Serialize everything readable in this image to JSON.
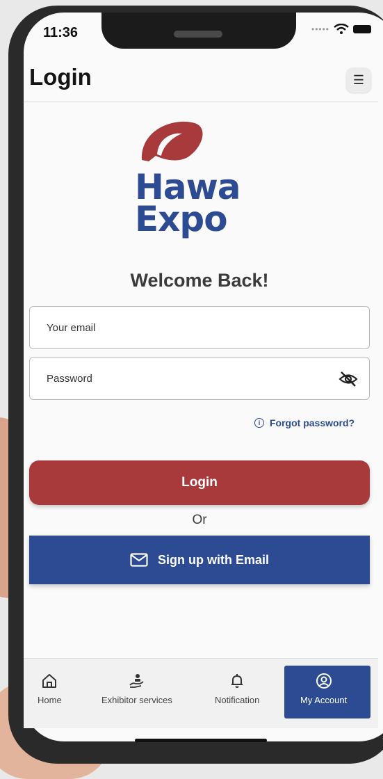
{
  "status": {
    "time": "11:36"
  },
  "header": {
    "title": "Login",
    "menu_icon": "menu-icon"
  },
  "logo": {
    "line1": "Hawa",
    "line2": "Expo",
    "brand_red": "#a83a3c",
    "brand_blue": "#2d4b93"
  },
  "welcome": "Welcome Back!",
  "form": {
    "email_placeholder": "Your email",
    "password_placeholder": "Password",
    "forgot_label": "Forgot password?",
    "login_label": "Login",
    "or_label": "Or",
    "signup_label": "Sign up with Email"
  },
  "nav": {
    "items": [
      {
        "label": "Home",
        "icon": "home-icon"
      },
      {
        "label": "Exhibitor services",
        "icon": "hand-service-icon"
      },
      {
        "label": "Notification",
        "icon": "bell-icon"
      },
      {
        "label": "My Account",
        "icon": "user-circle-icon",
        "active": true
      }
    ]
  }
}
